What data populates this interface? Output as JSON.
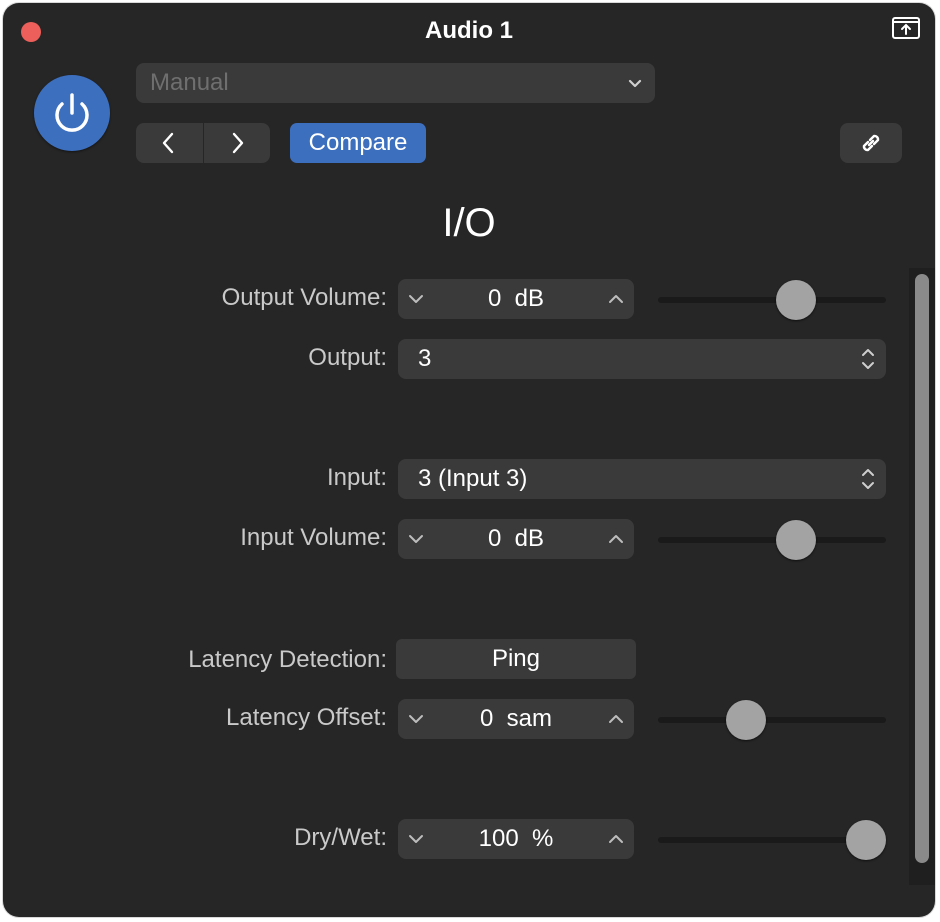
{
  "window": {
    "title": "Audio 1"
  },
  "toolbar": {
    "preset_value": "Manual",
    "compare_label": "Compare"
  },
  "section_title": "I/O",
  "controls": {
    "output_volume": {
      "label": "Output Volume:",
      "value": "0  dB",
      "slider_fraction": 0.63
    },
    "output": {
      "label": "Output:",
      "value": "3"
    },
    "input": {
      "label": "Input:",
      "value": "3 (Input 3)"
    },
    "input_volume": {
      "label": "Input Volume:",
      "value": "0  dB",
      "slider_fraction": 0.63
    },
    "latency_detection": {
      "label": "Latency Detection:",
      "button_label": "Ping"
    },
    "latency_offset": {
      "label": "Latency Offset:",
      "value": "0  sam",
      "slider_fraction": 0.36
    },
    "dry_wet": {
      "label": "Dry/Wet:",
      "value": "100  %",
      "slider_fraction": 1.0
    }
  },
  "colors": {
    "accent": "#3d6fbf",
    "close": "#ec5f5a",
    "panel": "#262626",
    "control": "#3a3a3a"
  },
  "icons": [
    "close-icon",
    "pin-icon",
    "power-icon",
    "chevron-down-icon",
    "chevron-left-icon",
    "chevron-right-icon",
    "link-icon",
    "stepper-down-icon",
    "stepper-up-icon",
    "updown-icon"
  ]
}
